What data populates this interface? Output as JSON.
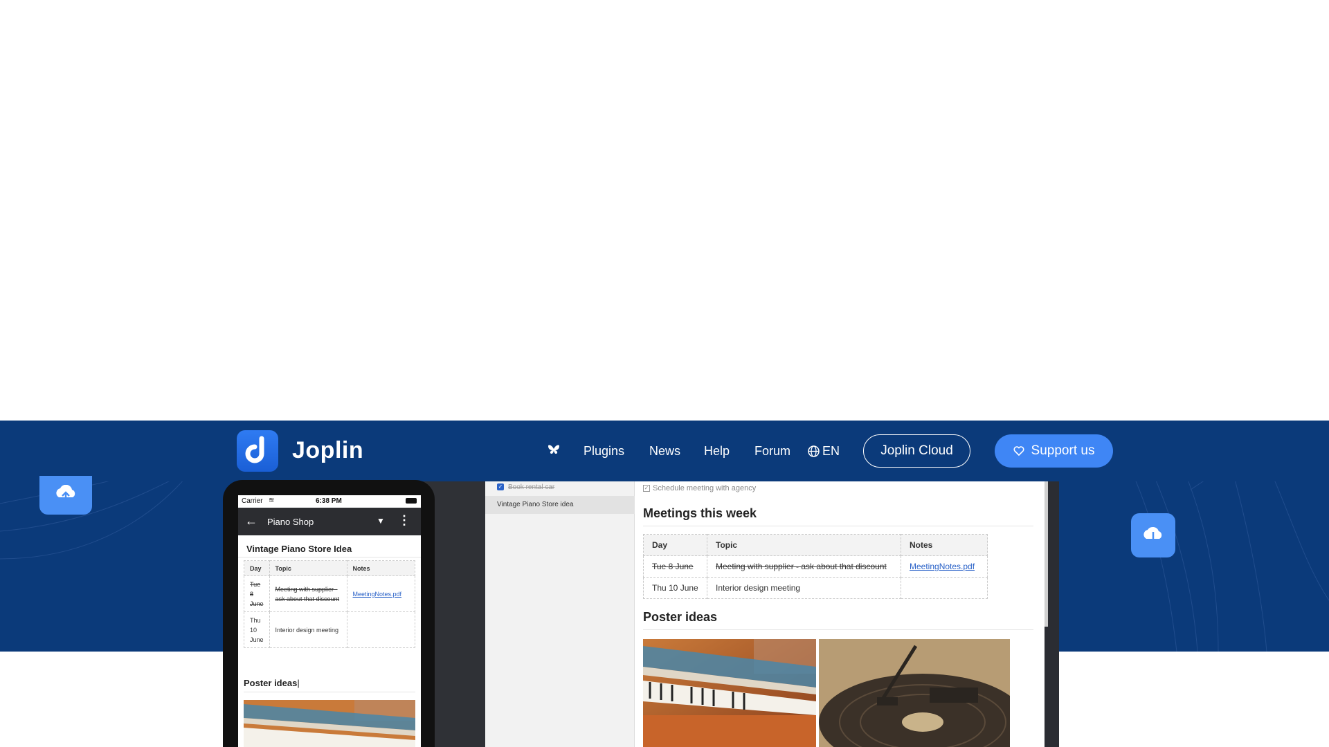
{
  "brand": {
    "name": "Joplin",
    "logo_letter": "J",
    "color": "#0b3a7a",
    "accent": "#3f86f5"
  },
  "nav": {
    "bluesky_icon": "butterfly-icon",
    "items": [
      "Plugins",
      "News",
      "Help",
      "Forum"
    ],
    "language": "EN",
    "cloud_button": "Joplin Cloud",
    "support_button": "Support us"
  },
  "desktop": {
    "list": [
      {
        "label": "Book rental car",
        "done": true
      },
      {
        "label": "Vintage Piano Store idea",
        "selected": true
      }
    ],
    "note": {
      "checklist_item": "Schedule meeting with agency",
      "meetings_heading": "Meetings this week",
      "table": {
        "headers": [
          "Day",
          "Topic",
          "Notes"
        ],
        "rows": [
          {
            "day": "Tue 8 June",
            "topic": "Meeting with supplier - ask about that discount",
            "notes": "MeetingNotes.pdf",
            "done": true
          },
          {
            "day": "Thu 10 June",
            "topic": "Interior design meeting",
            "notes": ""
          }
        ]
      },
      "poster_heading": "Poster ideas"
    }
  },
  "phone": {
    "status": {
      "carrier": "Carrier",
      "time": "6:38 PM"
    },
    "notebook": "Piano Shop",
    "note_title": "Vintage Piano Store Idea",
    "table": {
      "headers": [
        "Day",
        "Topic",
        "Notes"
      ],
      "rows": [
        {
          "day": "Tue 8 June",
          "topic": "Meeting with supplier - ask about that discount",
          "notes": "MeetingNotes.pdf"
        },
        {
          "day": "Thu 10 June",
          "topic": "Interior design meeting",
          "notes": ""
        }
      ]
    },
    "poster_heading": "Poster ideas"
  }
}
